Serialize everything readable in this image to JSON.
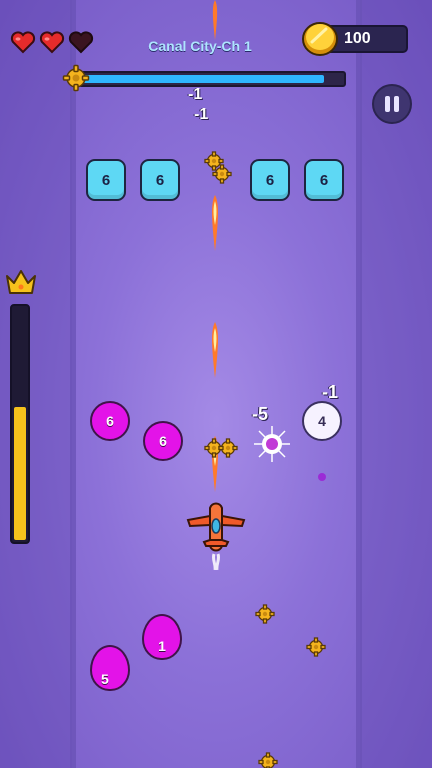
{
  "hud": {
    "level_title": "Canal City-Ch 1",
    "lives_total": 3,
    "lives_remaining": 2,
    "coins": "100",
    "level_progress": 0.93,
    "power_fill": 0.58
  },
  "colors": {
    "heart_full": "#e52b2b",
    "heart_empty": "#3a1420",
    "block": "#5ed8f4",
    "blob": "#e313e8",
    "progress": "#2fb6ff",
    "power": "#f6c21c"
  },
  "blocks": [
    "6",
    "6",
    "6",
    "6"
  ],
  "enemies": [
    "6",
    "6",
    "4",
    "1",
    "5"
  ],
  "damage_popups": [
    "-1",
    "-1",
    "-5",
    "-1"
  ],
  "icons": {
    "heart": "heart-icon",
    "coin": "coin-icon",
    "gear": "gear-icon",
    "pause": "pause-icon",
    "crown": "crown-icon",
    "plane": "player-plane"
  }
}
